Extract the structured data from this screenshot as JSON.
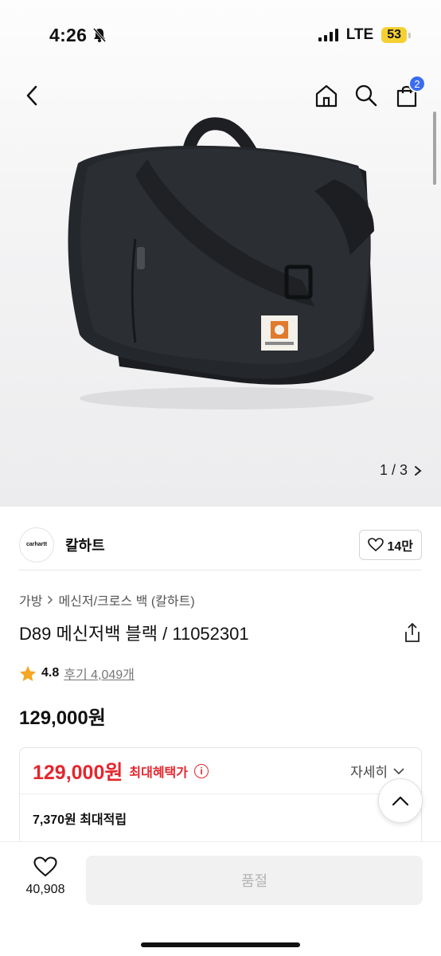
{
  "status_bar": {
    "time": "4:26",
    "network": "LTE",
    "battery": "53"
  },
  "nav": {
    "cart_count": "2"
  },
  "gallery": {
    "pager": "1 / 3"
  },
  "brand": {
    "logo_text": "carhartt",
    "name": "칼하트",
    "likes": "14만"
  },
  "breadcrumb": {
    "category": "가방",
    "subcategory": "메신저/크로스 백 (칼하트)"
  },
  "product": {
    "title": "D89 메신저백 블랙 / 11052301",
    "rating": "4.8",
    "reviews": "후기 4,049개",
    "price": "129,000원"
  },
  "benefit": {
    "best_price": "129,000원",
    "best_label": "최대혜택가",
    "detail_label": "자세히",
    "points": "7,370원 최대적립"
  },
  "bottom": {
    "wish_count": "40,908",
    "soldout_label": "품절"
  },
  "colors": {
    "accent_red": "#e5262d",
    "badge_blue": "#3a6df0",
    "star": "#f5a623"
  }
}
